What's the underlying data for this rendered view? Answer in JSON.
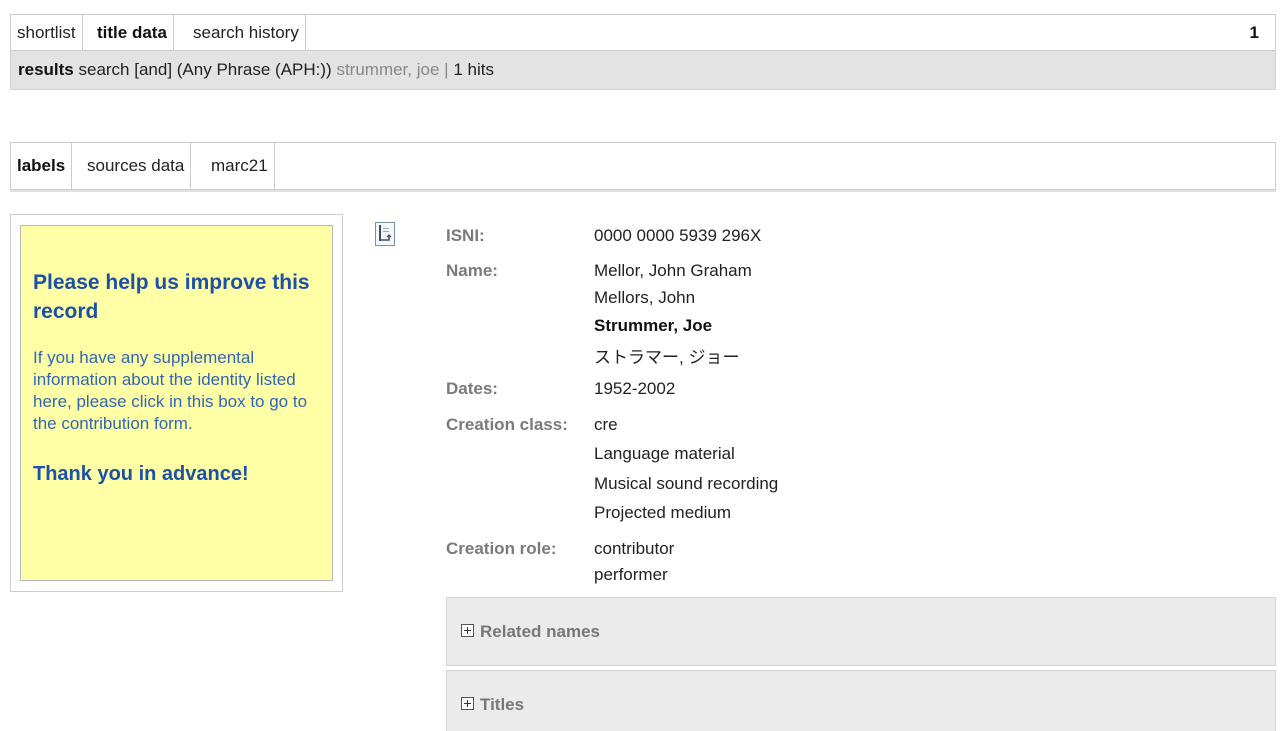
{
  "top_tabs": [
    {
      "label": "shortlist"
    },
    {
      "label": "title data"
    },
    {
      "label": "search history"
    }
  ],
  "page_number": "1",
  "results_bar": {
    "label": "results",
    "search_text": "search [and]  (Any Phrase (APH:))",
    "query": "strummer, joe",
    "separator": "|",
    "hits": "1 hits"
  },
  "view_tabs": [
    {
      "label": "labels"
    },
    {
      "label": "sources data"
    },
    {
      "label": "marc21"
    }
  ],
  "help_box": {
    "title": "Please help us improve this record",
    "text": "If you have any supplemental information about the identity listed here, please click in this box to go to the contribution form.",
    "thanks": "Thank you in advance!"
  },
  "record": {
    "isni_label": "ISNI:",
    "isni_value": "0000 0000 5939 296X",
    "name_label": "Name:",
    "names": [
      "Mellor, John Graham",
      "Mellors, John",
      "Strummer, Joe",
      "ストラマー, ジョー"
    ],
    "dates_label": "Dates:",
    "dates_value": "1952-2002",
    "creation_class_label": "Creation class:",
    "creation_classes": [
      "cre",
      "Language material",
      "Musical sound recording",
      "Projected medium"
    ],
    "creation_role_label": "Creation role:",
    "creation_roles": [
      "contributor",
      "performer"
    ]
  },
  "panels": [
    {
      "label": "Related names"
    },
    {
      "label": "Titles"
    }
  ],
  "icons": {
    "document": "document-icon",
    "expand": "plus-box-icon"
  }
}
